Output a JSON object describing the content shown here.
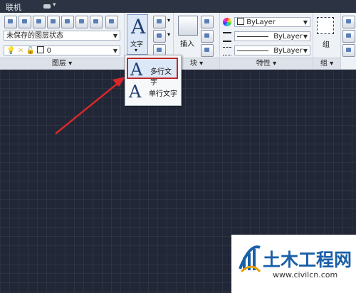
{
  "titlebar": {
    "menu_label": "联机",
    "camera_icon": "camera-icon"
  },
  "panels": {
    "layers": {
      "footer": "图层 ▾",
      "state_select": "未保存的图层状态",
      "layer_select": "0"
    },
    "annotation": {
      "text_button_label": "文字",
      "text_dropdown_arrow": "▾"
    },
    "block": {
      "insert_label": "插入",
      "footer": "块 ▾"
    },
    "properties": {
      "color_select": "ByLayer",
      "linetype_select": "ByLayer",
      "lineweight_select": "ByLayer",
      "footer": "特性 ▾"
    },
    "group": {
      "group_label": "组",
      "footer": "组 ▾"
    }
  },
  "dropdown": {
    "items": [
      {
        "label": "多行文字"
      },
      {
        "label": "单行文字"
      }
    ]
  },
  "watermark": {
    "name": "土木工程网",
    "url": "www.civilcn.com"
  },
  "colors": {
    "canvas_bg": "#212736",
    "ribbon_bg": "#eef1f5",
    "highlight_border": "#c0282d",
    "arrow": "#d8282b",
    "watermark_blue": "#1a5fa8"
  }
}
